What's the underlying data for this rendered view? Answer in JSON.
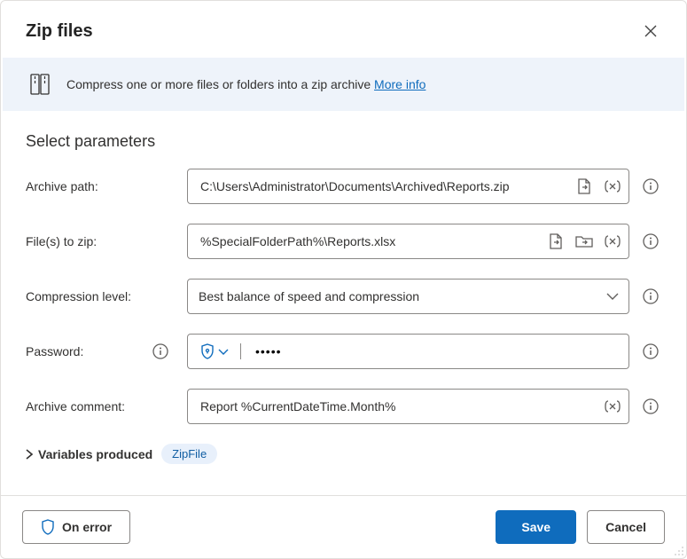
{
  "title": "Zip files",
  "banner": {
    "text": "Compress one or more files or folders into a zip archive ",
    "link": "More info"
  },
  "section_title": "Select parameters",
  "labels": {
    "archive_path": "Archive path:",
    "files_to_zip": "File(s) to zip:",
    "compression": "Compression level:",
    "password": "Password:",
    "archive_comment": "Archive comment:"
  },
  "values": {
    "archive_path": "C:\\Users\\Administrator\\Documents\\Archived\\Reports.zip",
    "files_to_zip": "%SpecialFolderPath%\\Reports.xlsx",
    "compression": "Best balance of speed and compression",
    "password": "•••••",
    "archive_comment": "Report %CurrentDateTime.Month%"
  },
  "variables": {
    "label": "Variables produced",
    "chip": "ZipFile"
  },
  "footer": {
    "on_error": "On error",
    "save": "Save",
    "cancel": "Cancel"
  }
}
